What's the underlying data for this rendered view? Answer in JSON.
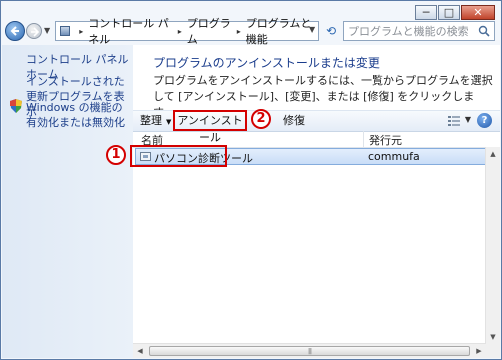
{
  "window": {
    "caption_buttons": {
      "minimize": "─",
      "maximize": "□",
      "close": "✕"
    }
  },
  "address_bar": {
    "separator": "▸",
    "breadcrumb": [
      "コントロール パネル",
      "プログラム",
      "プログラムと機能"
    ],
    "search_placeholder": "プログラムと機能の検索"
  },
  "sidebar": {
    "items": [
      {
        "label": "コントロール パネル ホーム"
      },
      {
        "label": "インストールされた更新プログラムを表示"
      },
      {
        "label": "Windows の機能の有効化または無効化",
        "icon": "shield-icon"
      }
    ]
  },
  "main": {
    "task_title": "プログラムのアンインストールまたは変更",
    "task_description": "プログラムをアンインストールするには、一覧からプログラムを選択して [アンインストール]、[変更]、または [修復] をクリックします。"
  },
  "toolbar": {
    "organize_label": "整理",
    "uninstall_label": "アンインストール",
    "repair_label": "修復",
    "help_label": "?"
  },
  "list": {
    "columns": [
      "名前",
      "発行元"
    ],
    "rows": [
      {
        "name": "パソコン診断ツール",
        "publisher": "commufa",
        "selected": true
      }
    ]
  },
  "annotations": {
    "callout_1": "1",
    "callout_2": "2",
    "highlight_color": "#d40000"
  }
}
